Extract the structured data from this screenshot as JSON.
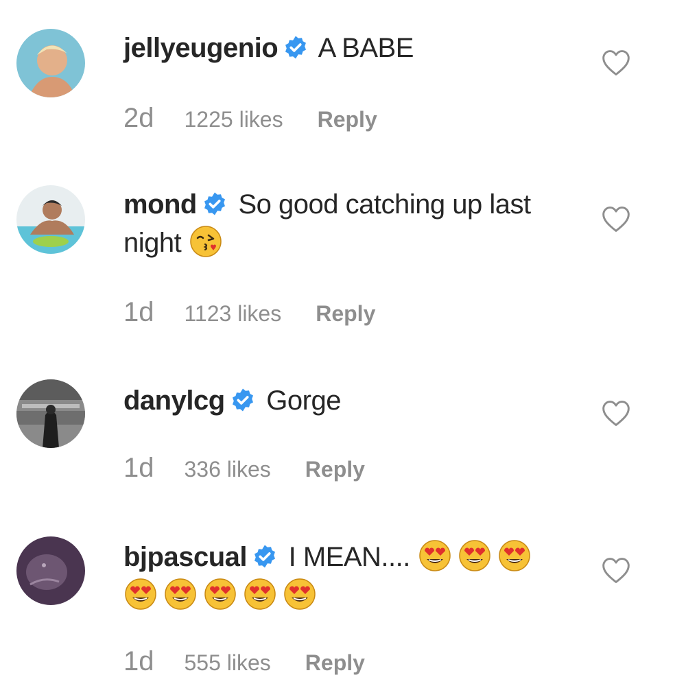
{
  "comments": [
    {
      "username": "jellyeugenio",
      "text": "A BABE",
      "time": "2d",
      "likes": "1225 likes",
      "reply_label": "Reply",
      "avatar": "avatar-photo-jellyeugenio",
      "emojis": []
    },
    {
      "username": "mond",
      "text": "So good catching up last night",
      "time": "1d",
      "likes": "1123 likes",
      "reply_label": "Reply",
      "avatar": "avatar-photo-mond",
      "emojis": [
        "face-blowing-kiss"
      ]
    },
    {
      "username": "danylcg",
      "text": "Gorge",
      "time": "1d",
      "likes": "336 likes",
      "reply_label": "Reply",
      "avatar": "avatar-photo-danylcg",
      "emojis": []
    },
    {
      "username": "bjpascual",
      "text": "I MEAN....",
      "time": "1d",
      "likes": "555 likes",
      "reply_label": "Reply",
      "avatar": "avatar-photo-bjpascual",
      "emojis": [
        "heart-eyes",
        "heart-eyes",
        "heart-eyes",
        "heart-eyes",
        "heart-eyes",
        "heart-eyes",
        "heart-eyes",
        "heart-eyes"
      ]
    }
  ],
  "icons": {
    "verified": "verified-badge-icon",
    "like": "heart-outline-icon"
  },
  "colors": {
    "verified_blue": "#3897f0",
    "meta_gray": "#8e8e8e",
    "text": "#262626"
  }
}
